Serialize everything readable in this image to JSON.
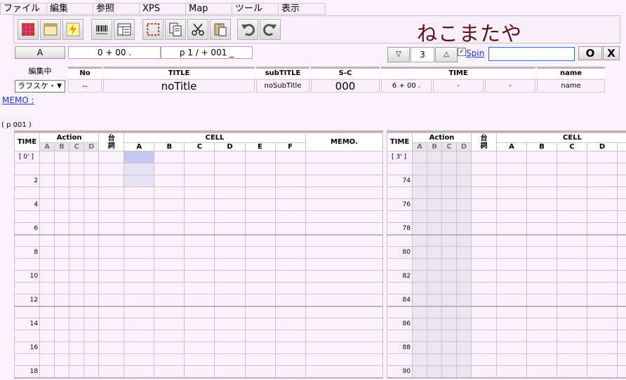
{
  "menu": [
    "ファイル",
    "編集",
    "参照",
    "XPS",
    "Map",
    "ツール",
    "表示"
  ],
  "toolbar": {
    "icons": [
      "grid-menu-icon",
      "calendar-icon",
      "lightning-icon",
      "barcode-icon",
      "layout-icon",
      "selection-icon",
      "copy-icon",
      "scissors-icon",
      "paste-icon",
      "undo-icon",
      "redo-icon"
    ],
    "logo": "ねこまたや"
  },
  "nav": {
    "a_label": "A",
    "timecode": "0 + 00 .",
    "page": "p 1 / + 001 _",
    "spin_down": "▽",
    "spin_value": "3",
    "spin_up": "△",
    "spin_check": "✓",
    "spin_label": "Spin",
    "input_value": "",
    "ok": "O",
    "close": "X"
  },
  "info": {
    "headers": [
      "編集中",
      "No",
      "TITLE",
      "subTITLE",
      "S-C",
      "TIME",
      "name"
    ],
    "mode_value": "ラフスケ・",
    "no": "--",
    "title": "noTitle",
    "subtitle": "noSubTitle",
    "sc": "000",
    "time": [
      "6 + 00 .",
      "-",
      "-"
    ],
    "name": "name"
  },
  "memo_link": "MEMO :",
  "page_label": "( p 001 )",
  "sheet": {
    "time_label": "TIME",
    "action_label": "Action",
    "dialog_label": "台\n詞",
    "cell_label": "CELL",
    "memo_label": "MEMO.",
    "action_cols": [
      "A",
      "B",
      "C",
      "D"
    ],
    "cell_cols_left": [
      "A",
      "B",
      "C",
      "D",
      "E",
      "F"
    ],
    "cell_cols_right": [
      "A",
      "B",
      "C",
      "D"
    ],
    "left_start": "[ 0' ]",
    "right_start": "[ 3' ]",
    "left_frames": [
      "",
      "2",
      "",
      "4",
      "",
      "6",
      "",
      "8",
      "",
      "10",
      "",
      "12",
      "",
      "14",
      "",
      "16",
      "",
      "18"
    ],
    "right_frames": [
      "",
      "74",
      "",
      "76",
      "",
      "78",
      "",
      "80",
      "",
      "82",
      "",
      "84",
      "",
      "86",
      "",
      "88",
      "",
      "90"
    ]
  }
}
